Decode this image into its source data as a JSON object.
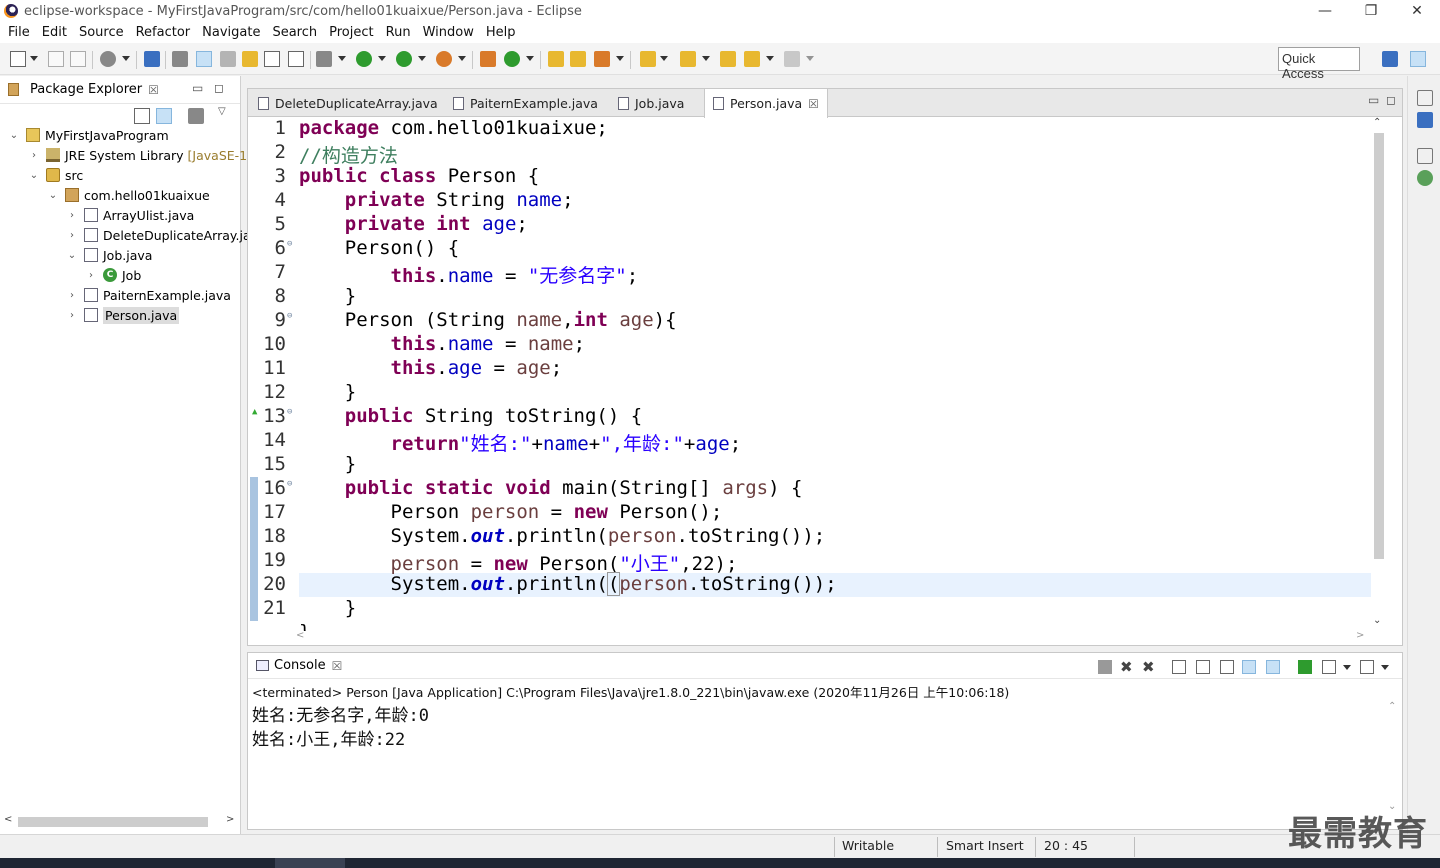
{
  "window": {
    "title": "eclipse-workspace - MyFirstJavaProgram/src/com/hello01kuaixue/Person.java - Eclipse",
    "minimize": "—",
    "maximize": "❐",
    "close": "✕"
  },
  "menu": [
    "File",
    "Edit",
    "Source",
    "Refactor",
    "Navigate",
    "Search",
    "Project",
    "Run",
    "Window",
    "Help"
  ],
  "toolbar": {
    "quick_access": "Quick Access"
  },
  "package_explorer": {
    "title": "Package Explorer",
    "close": "☒",
    "tree": [
      {
        "label": "MyFirstJavaProgram",
        "arrow": "⌄",
        "icon": "project-icon"
      },
      {
        "label": "JRE System Library",
        "extra": "[JavaSE-1.",
        "arrow": "›",
        "icon": "library-icon"
      },
      {
        "label": "src",
        "arrow": "⌄",
        "icon": "source-folder-icon"
      },
      {
        "label": "com.hello01kuaixue",
        "arrow": "⌄",
        "icon": "package-icon"
      },
      {
        "label": "ArrayUlist.java",
        "arrow": "›",
        "icon": "java-file-icon"
      },
      {
        "label": "DeleteDuplicateArray.ja",
        "arrow": "›",
        "icon": "java-file-icon"
      },
      {
        "label": "Job.java",
        "arrow": "⌄",
        "icon": "java-file-icon"
      },
      {
        "label": "Job",
        "arrow": "›",
        "icon": "class-icon"
      },
      {
        "label": "PaiternExample.java",
        "arrow": "›",
        "icon": "java-file-icon"
      },
      {
        "label": "Person.java",
        "arrow": "›",
        "icon": "java-file-icon"
      }
    ]
  },
  "editor": {
    "tabs": [
      {
        "label": "DeleteDuplicateArray.java"
      },
      {
        "label": "PaiternExample.java"
      },
      {
        "label": "Job.java"
      },
      {
        "label": "Person.java",
        "close": "☒"
      }
    ],
    "line_numbers": [
      "1",
      "2",
      "3",
      "4",
      "5",
      "6",
      "7",
      "8",
      "9",
      "10",
      "11",
      "12",
      "13",
      "14",
      "15",
      "16",
      "17",
      "18",
      "19",
      "20",
      "21"
    ],
    "fold_markers": {
      "6": "⊖",
      "9": "⊖",
      "13": "⊖",
      "16": "⊖"
    },
    "override_marker": "▲"
  },
  "console": {
    "title": "Console",
    "close": "☒",
    "terminated": "<terminated> Person [Java Application] C:\\Program Files\\Java\\jre1.8.0_221\\bin\\javaw.exe (2020年11月26日 上午10:06:18)",
    "output": [
      "姓名:无参名字,年龄:0",
      "姓名:小王,年龄:22"
    ]
  },
  "status": {
    "writable": "Writable",
    "insert_mode": "Smart Insert",
    "position": "20 : 45"
  },
  "watermark": "最需教育"
}
